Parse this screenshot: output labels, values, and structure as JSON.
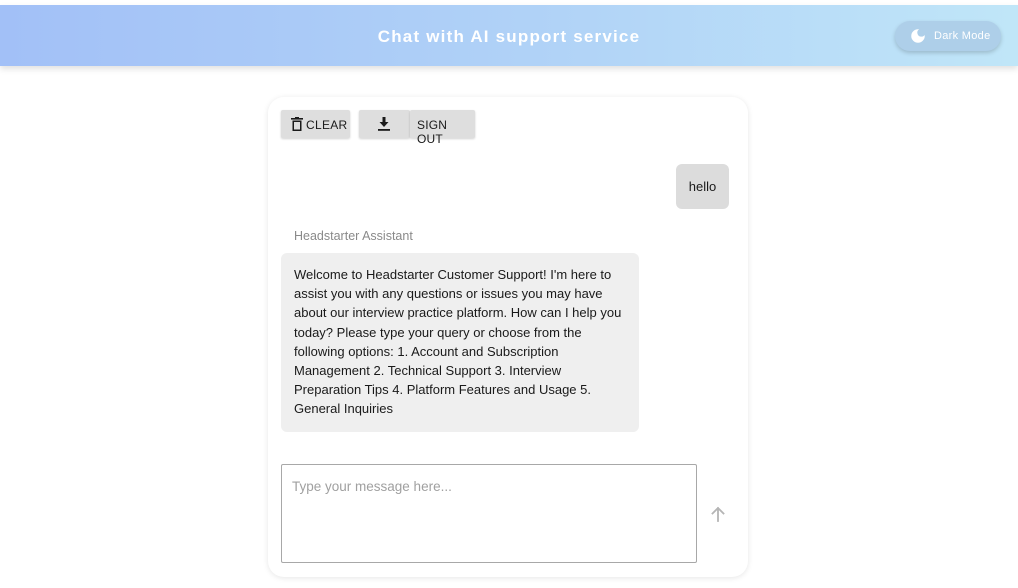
{
  "header": {
    "title": "Chat with AI support service",
    "dark_mode_label": "Dark Mode",
    "dark_mode_icon": "moon-icon"
  },
  "toolbar": {
    "clear_label": "CLEAR",
    "clear_icon": "trash-icon",
    "download_icon": "download-icon",
    "signout_label": "SIGN OUT"
  },
  "messages": [
    {
      "role": "user",
      "text": "hello"
    },
    {
      "role": "assistant",
      "sender": "Headstarter Assistant",
      "text": "Welcome to Headstarter Customer Support! I'm here to assist you with any questions or issues you may have about our interview practice platform. How can I help you today? Please type your query or choose from the following options: 1. Account and Subscription Management 2. Technical Support 3. Interview Preparation Tips 4. Platform Features and Usage 5. General Inquiries"
    }
  ],
  "composer": {
    "placeholder": "Type your message here...",
    "value": "",
    "send_icon": "arrow-up-icon"
  },
  "colors": {
    "header_gradient_start": "#a2c0f7",
    "header_gradient_end": "#c0e6f8",
    "toolbar_button_bg": "#dedede",
    "user_bubble_bg": "#dcdcdc",
    "assistant_bubble_bg": "#efefef"
  }
}
